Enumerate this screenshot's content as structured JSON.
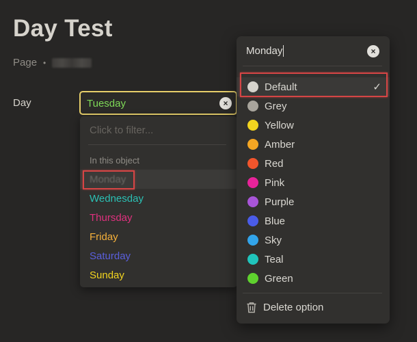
{
  "page": {
    "title": "Day Test",
    "meta_label": "Page",
    "meta_separator": "•"
  },
  "property": {
    "label": "Day",
    "current_value": "Tuesday",
    "current_color": "#7ed957"
  },
  "dropdown": {
    "filter_placeholder": "Click to filter...",
    "section_label": "In this object",
    "options": [
      {
        "label": "Monday",
        "color": "#6c6965"
      },
      {
        "label": "Wednesday",
        "color": "#2bc0b4"
      },
      {
        "label": "Thursday",
        "color": "#e0307e"
      },
      {
        "label": "Friday",
        "color": "#f5b03a"
      },
      {
        "label": "Saturday",
        "color": "#5a5fdc"
      },
      {
        "label": "Sunday",
        "color": "#f2d41f"
      }
    ]
  },
  "color_menu": {
    "input_value": "Monday",
    "colors": [
      {
        "name": "Default",
        "swatch": "#d6d3cc",
        "selected": true
      },
      {
        "name": "Grey",
        "swatch": "#a8a49c",
        "selected": false
      },
      {
        "name": "Yellow",
        "swatch": "#f2d41f",
        "selected": false
      },
      {
        "name": "Amber",
        "swatch": "#f5a623",
        "selected": false
      },
      {
        "name": "Red",
        "swatch": "#f2552c",
        "selected": false
      },
      {
        "name": "Pink",
        "swatch": "#e8239a",
        "selected": false
      },
      {
        "name": "Purple",
        "swatch": "#a855d8",
        "selected": false
      },
      {
        "name": "Blue",
        "swatch": "#4a5ce8",
        "selected": false
      },
      {
        "name": "Sky",
        "swatch": "#32a4ea",
        "selected": false
      },
      {
        "name": "Teal",
        "swatch": "#20c4bc",
        "selected": false
      },
      {
        "name": "Green",
        "swatch": "#5fd12e",
        "selected": false
      }
    ],
    "check_glyph": "✓",
    "delete_label": "Delete option"
  },
  "icons": {
    "clear": "×",
    "delete": "trash-icon",
    "check": "checkmark-icon"
  },
  "highlight_color": "#d64545"
}
